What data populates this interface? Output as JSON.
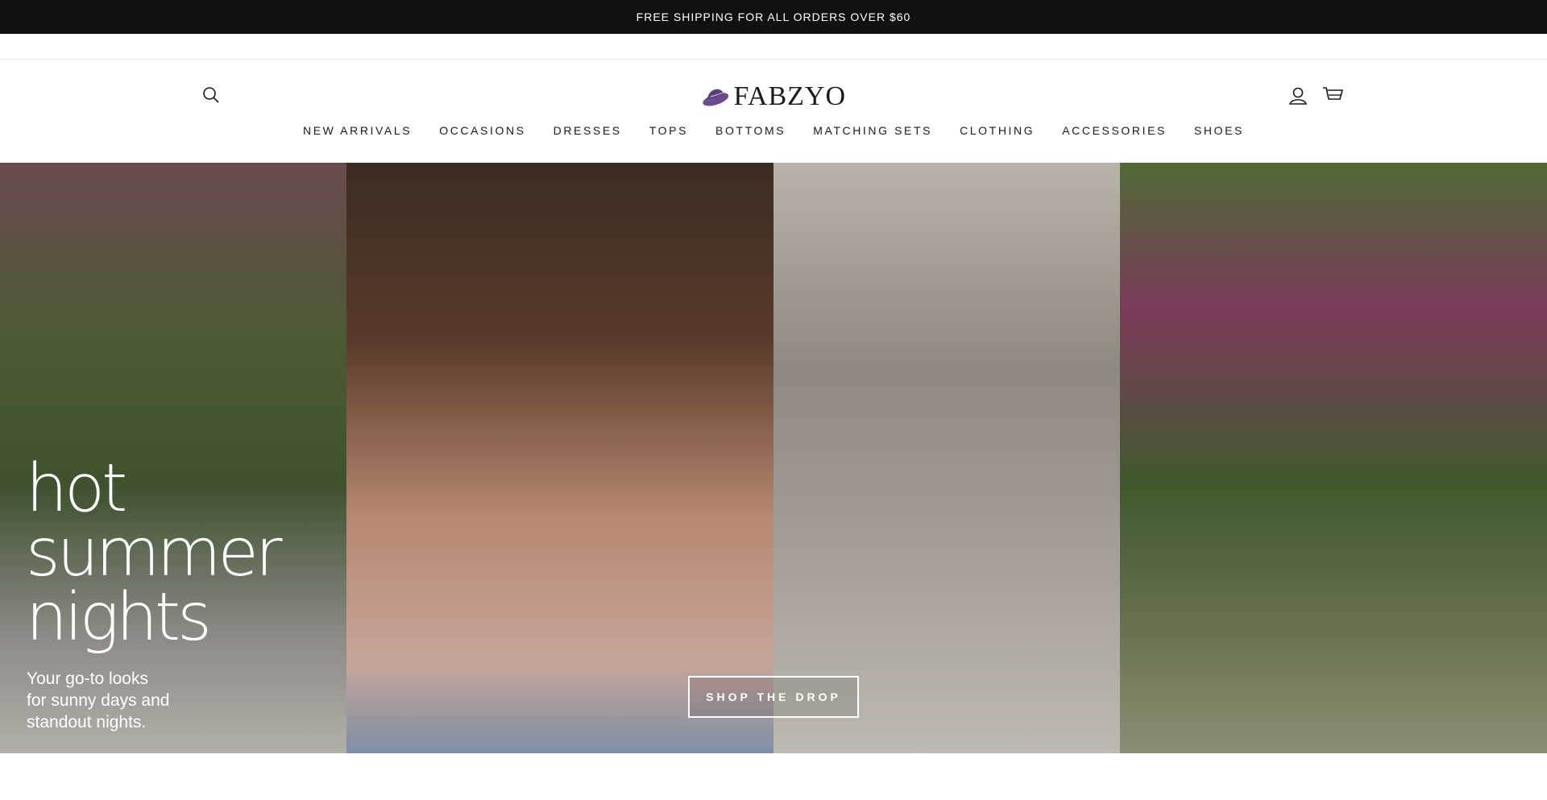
{
  "announcement": {
    "text": "FREE SHIPPING FOR ALL ORDERS OVER $60"
  },
  "header": {
    "logo_text": "FABZYO",
    "logo_color": "#6b4d8c",
    "icons": {
      "search": "search-icon",
      "account": "user-icon",
      "cart": "cart-icon"
    }
  },
  "nav": {
    "items": [
      {
        "label": "NEW ARRIVALS"
      },
      {
        "label": "OCCASIONS"
      },
      {
        "label": "DRESSES"
      },
      {
        "label": "TOPS"
      },
      {
        "label": "BOTTOMS"
      },
      {
        "label": "MATCHING SETS"
      },
      {
        "label": "CLOTHING"
      },
      {
        "label": "ACCESSORIES"
      },
      {
        "label": "SHOES"
      }
    ]
  },
  "hero": {
    "title_lines": [
      "hot",
      "summer",
      "nights"
    ],
    "subtitle_lines": [
      "Your go-to looks",
      "for sunny days and",
      "standout nights."
    ],
    "cta_label": "SHOP THE DROP"
  },
  "colors": {
    "announcement_bg": "#111111",
    "text": "#1a1a1a",
    "white": "#ffffff"
  }
}
